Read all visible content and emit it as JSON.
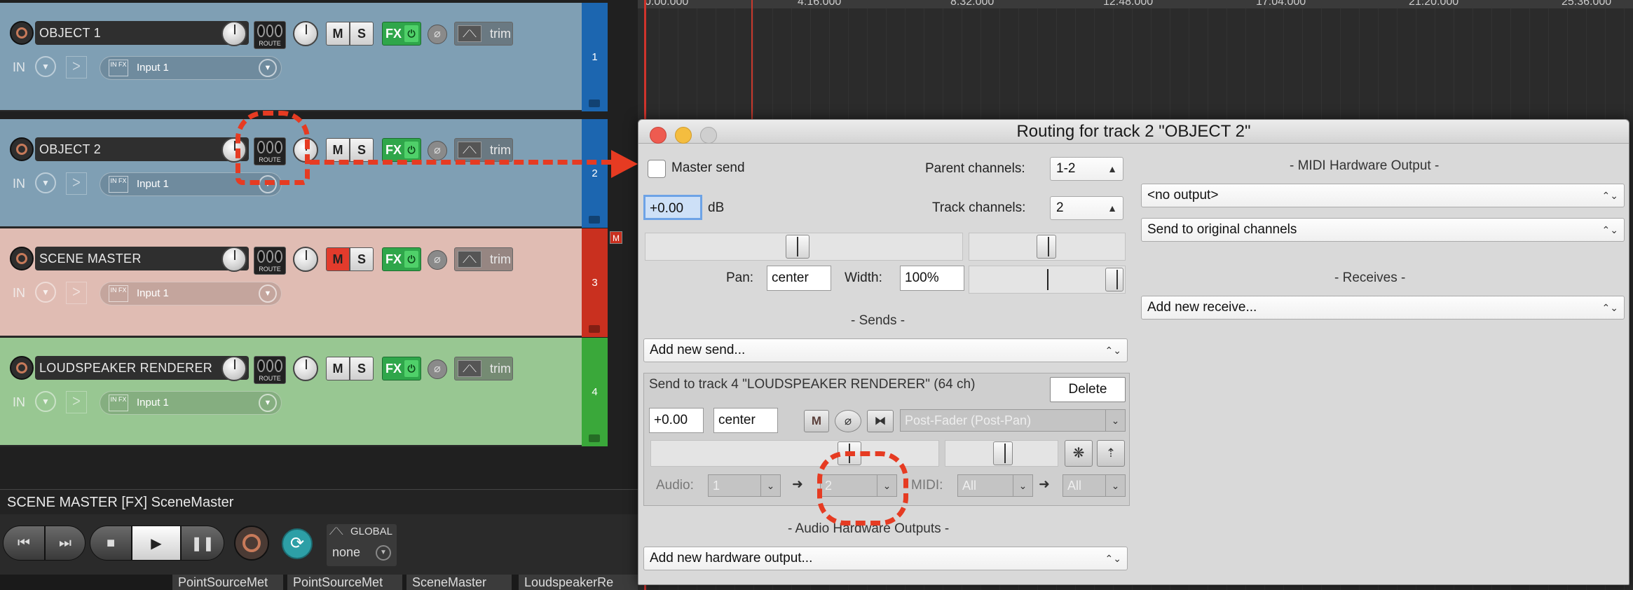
{
  "tracks": [
    {
      "name": "OBJECT 1",
      "number": "1",
      "input": "Input 1",
      "muted": false,
      "bg": "#7f9fb4",
      "color": "#1c66b0"
    },
    {
      "name": "OBJECT 2",
      "number": "2",
      "input": "Input 1",
      "muted": false,
      "bg": "#7f9fb4",
      "color": "#1c66b0"
    },
    {
      "name": "SCENE MASTER",
      "number": "3",
      "input": "Input 1",
      "muted": true,
      "bg": "#e0bcb3",
      "color": "#c9301f"
    },
    {
      "name": "LOUDSPEAKER RENDERER",
      "number": "4",
      "input": "Input 1",
      "muted": false,
      "bg": "#98c792",
      "color": "#3aa83a"
    }
  ],
  "track_controls": {
    "route_label": "ROUTE",
    "m_label": "M",
    "s_label": "S",
    "fx_label": "FX",
    "env_label": "trim",
    "in_label": "IN",
    "infx_label": "IN FX",
    "master_badge": "M"
  },
  "fx_status": "SCENE MASTER [FX] SceneMaster",
  "transport": {
    "global_label": "GLOBAL",
    "global_value": "none"
  },
  "bottom_tabs": [
    "PointSourceMet",
    "PointSourceMet",
    "SceneMaster",
    "LoudspeakerRe"
  ],
  "ruler": [
    "0:00.000",
    "4:16.000",
    "8:32.000",
    "12:48.000",
    "17:04.000",
    "21:20.000",
    "25:36.000"
  ],
  "routing": {
    "title": "Routing for track 2 \"OBJECT 2\"",
    "master_send_label": "Master send",
    "master_send_checked": false,
    "volume": "+0.00",
    "db_label": "dB",
    "parent_channels_label": "Parent channels:",
    "parent_channels": "1-2",
    "track_channels_label": "Track channels:",
    "track_channels": "2",
    "pan_label": "Pan:",
    "pan": "center",
    "width_label": "Width:",
    "width": "100%",
    "sends_header": "-  Sends  -",
    "add_send": "Add new send...",
    "send": {
      "title": "Send to track 4 \"LOUDSPEAKER RENDERER\" (64 ch)",
      "delete_label": "Delete",
      "volume": "+0.00",
      "pan": "center",
      "mute_label": "M",
      "mode": "Post-Fader (Post-Pan)",
      "audio_label": "Audio:",
      "audio_src": "1",
      "audio_dst": "2",
      "midi_label": "MIDI:",
      "midi_src": "All",
      "midi_dst": "All"
    },
    "hw_outputs_header": "-  Audio Hardware Outputs  -",
    "add_hw_output": "Add new hardware output...",
    "midi_hw_header": "-  MIDI Hardware Output  -",
    "midi_output": "<no output>",
    "midi_channels": "Send to original channels",
    "receives_header": "-  Receives  -",
    "add_receive": "Add new receive..."
  },
  "accent": "#e63b22"
}
